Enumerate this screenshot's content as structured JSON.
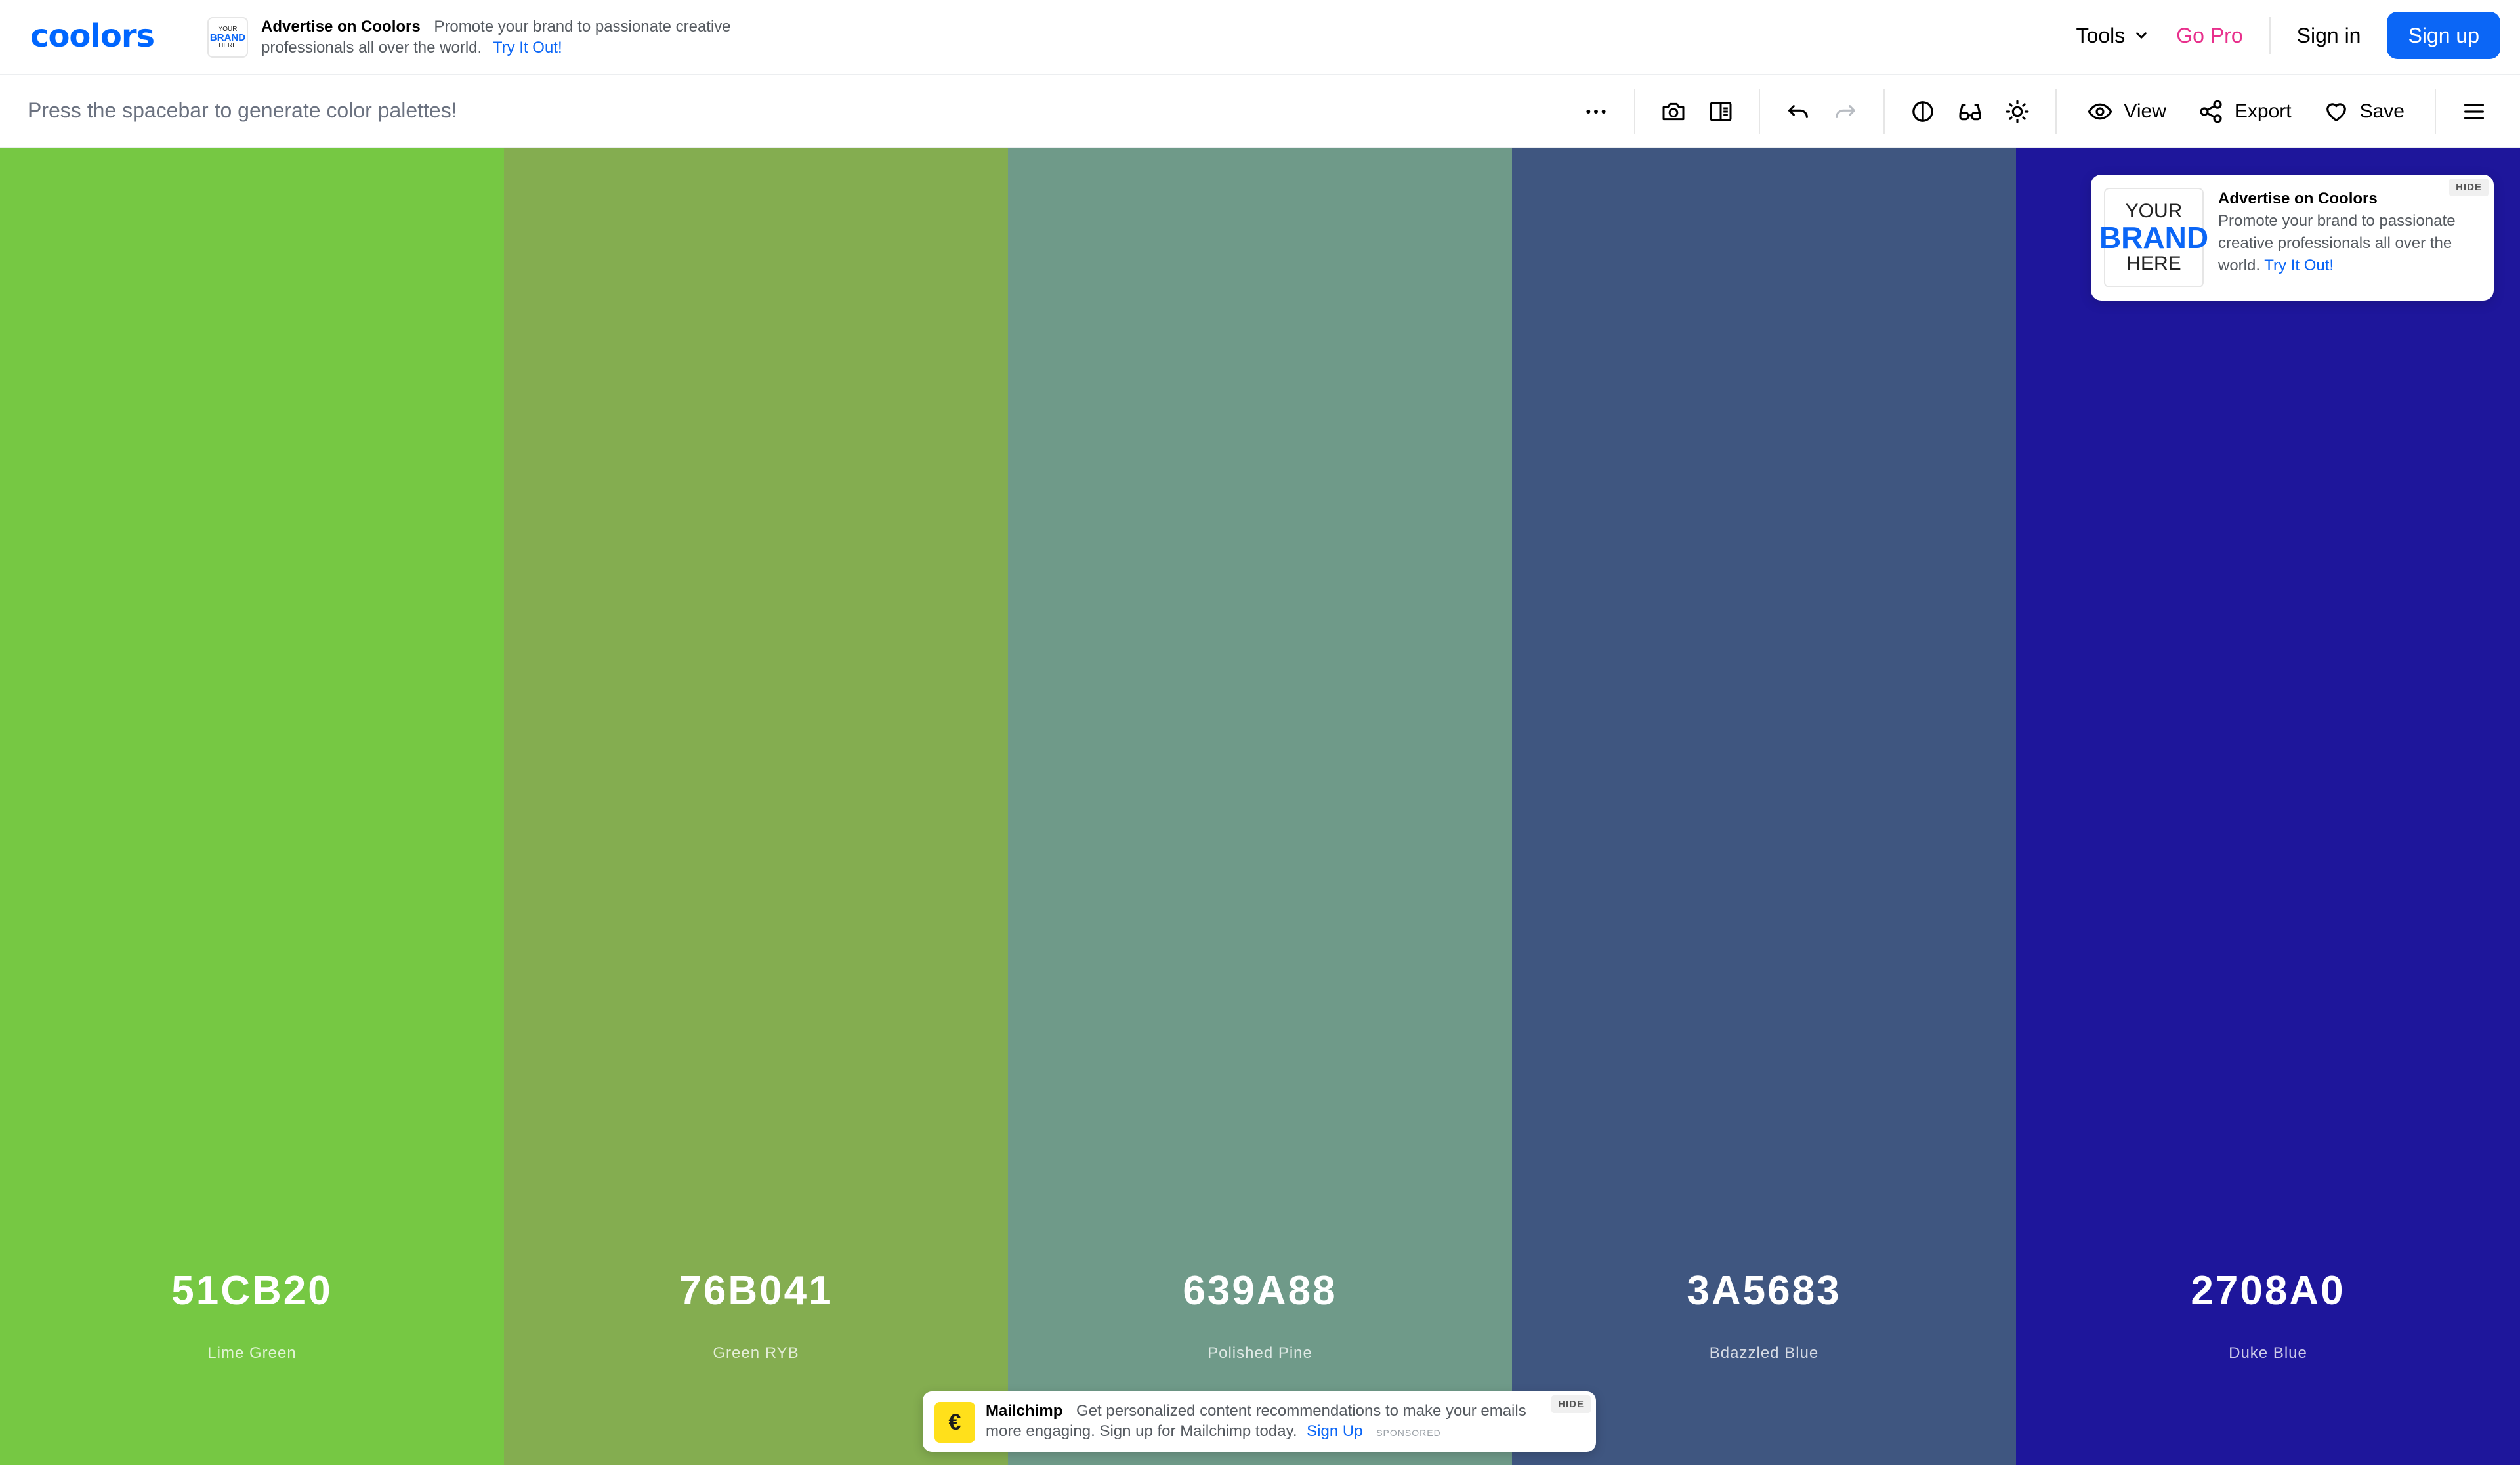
{
  "navbar": {
    "logo": "coolors",
    "ad": {
      "brand_thumb": [
        "YOUR",
        "BRAND",
        "HERE"
      ],
      "title": "Advertise on Coolors",
      "text": "Promote your brand to passionate creative professionals all over the world.",
      "cta": "Try It Out!"
    },
    "tools_label": "Tools",
    "gopro_label": "Go Pro",
    "signin_label": "Sign in",
    "signup_label": "Sign up"
  },
  "toolbar": {
    "hint": "Press the spacebar to generate color palettes!",
    "view_label": "View",
    "export_label": "Export",
    "save_label": "Save",
    "icons": [
      "more-options-icon",
      "camera-icon",
      "side-panel-icon",
      "undo-icon",
      "redo-icon",
      "contrast-icon",
      "glasses-icon",
      "brightness-icon",
      "eye-icon",
      "share-icon",
      "heart-icon",
      "menu-icon"
    ]
  },
  "palette": [
    {
      "hex": "51CB20",
      "name": "Lime Green",
      "color": "#76c843"
    },
    {
      "hex": "76B041",
      "name": "Green RYB",
      "color": "#84ad50"
    },
    {
      "hex": "639A88",
      "name": "Polished Pine",
      "color": "#6f9a89"
    },
    {
      "hex": "3A5683",
      "name": "Bdazzled Blue",
      "color": "#3f5680"
    },
    {
      "hex": "2708A0",
      "name": "Duke Blue",
      "color": "#1e169b"
    }
  ],
  "ad_card": {
    "brand_thumb": [
      "YOUR",
      "BRAND",
      "HERE"
    ],
    "title": "Advertise on Coolors",
    "text": "Promote your brand to passionate creative professionals all over the world.",
    "cta": "Try It Out!",
    "hide_label": "HIDE"
  },
  "sponsor": {
    "title": "Mailchimp",
    "text": "Get personalized content recommendations to make your emails more engaging. Sign up for Mailchimp today.",
    "cta": "Sign Up",
    "tag": "SPONSORED",
    "hide_label": "HIDE"
  }
}
